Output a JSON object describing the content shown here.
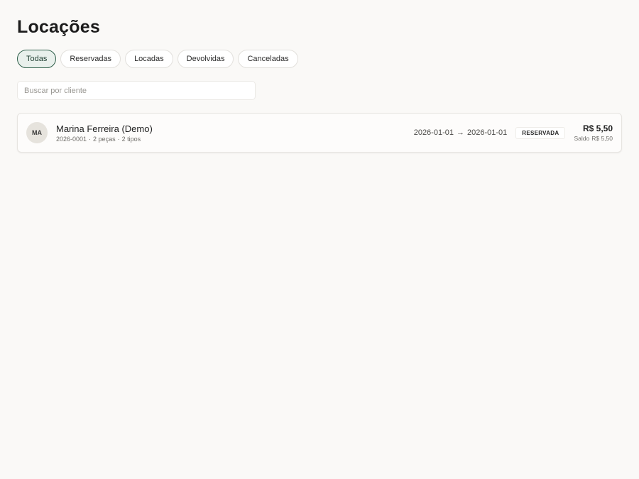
{
  "page": {
    "title": "Locações"
  },
  "filters": [
    {
      "label": "Todas",
      "active": true
    },
    {
      "label": "Reservadas",
      "active": false
    },
    {
      "label": "Locadas",
      "active": false
    },
    {
      "label": "Devolvidas",
      "active": false
    },
    {
      "label": "Canceladas",
      "active": false
    }
  ],
  "search": {
    "placeholder": "Buscar por cliente",
    "value": ""
  },
  "rentals": [
    {
      "initials": "MA",
      "client": "Marina Ferreira (Demo)",
      "code": "2026-0001",
      "separator": "·",
      "pieces": "2 peças",
      "types": "2 tipos",
      "start_date": "2026-01-01",
      "arrow": "→",
      "end_date": "2026-01-01",
      "status": "RESERVADA",
      "total": "R$ 5,50",
      "balance_label": "Saldo",
      "balance_value": "R$ 5,50"
    }
  ],
  "colors": {
    "accent": "#2f5f4a",
    "active_chip_bg": "#e9f0ec",
    "background": "#faf9f7"
  }
}
